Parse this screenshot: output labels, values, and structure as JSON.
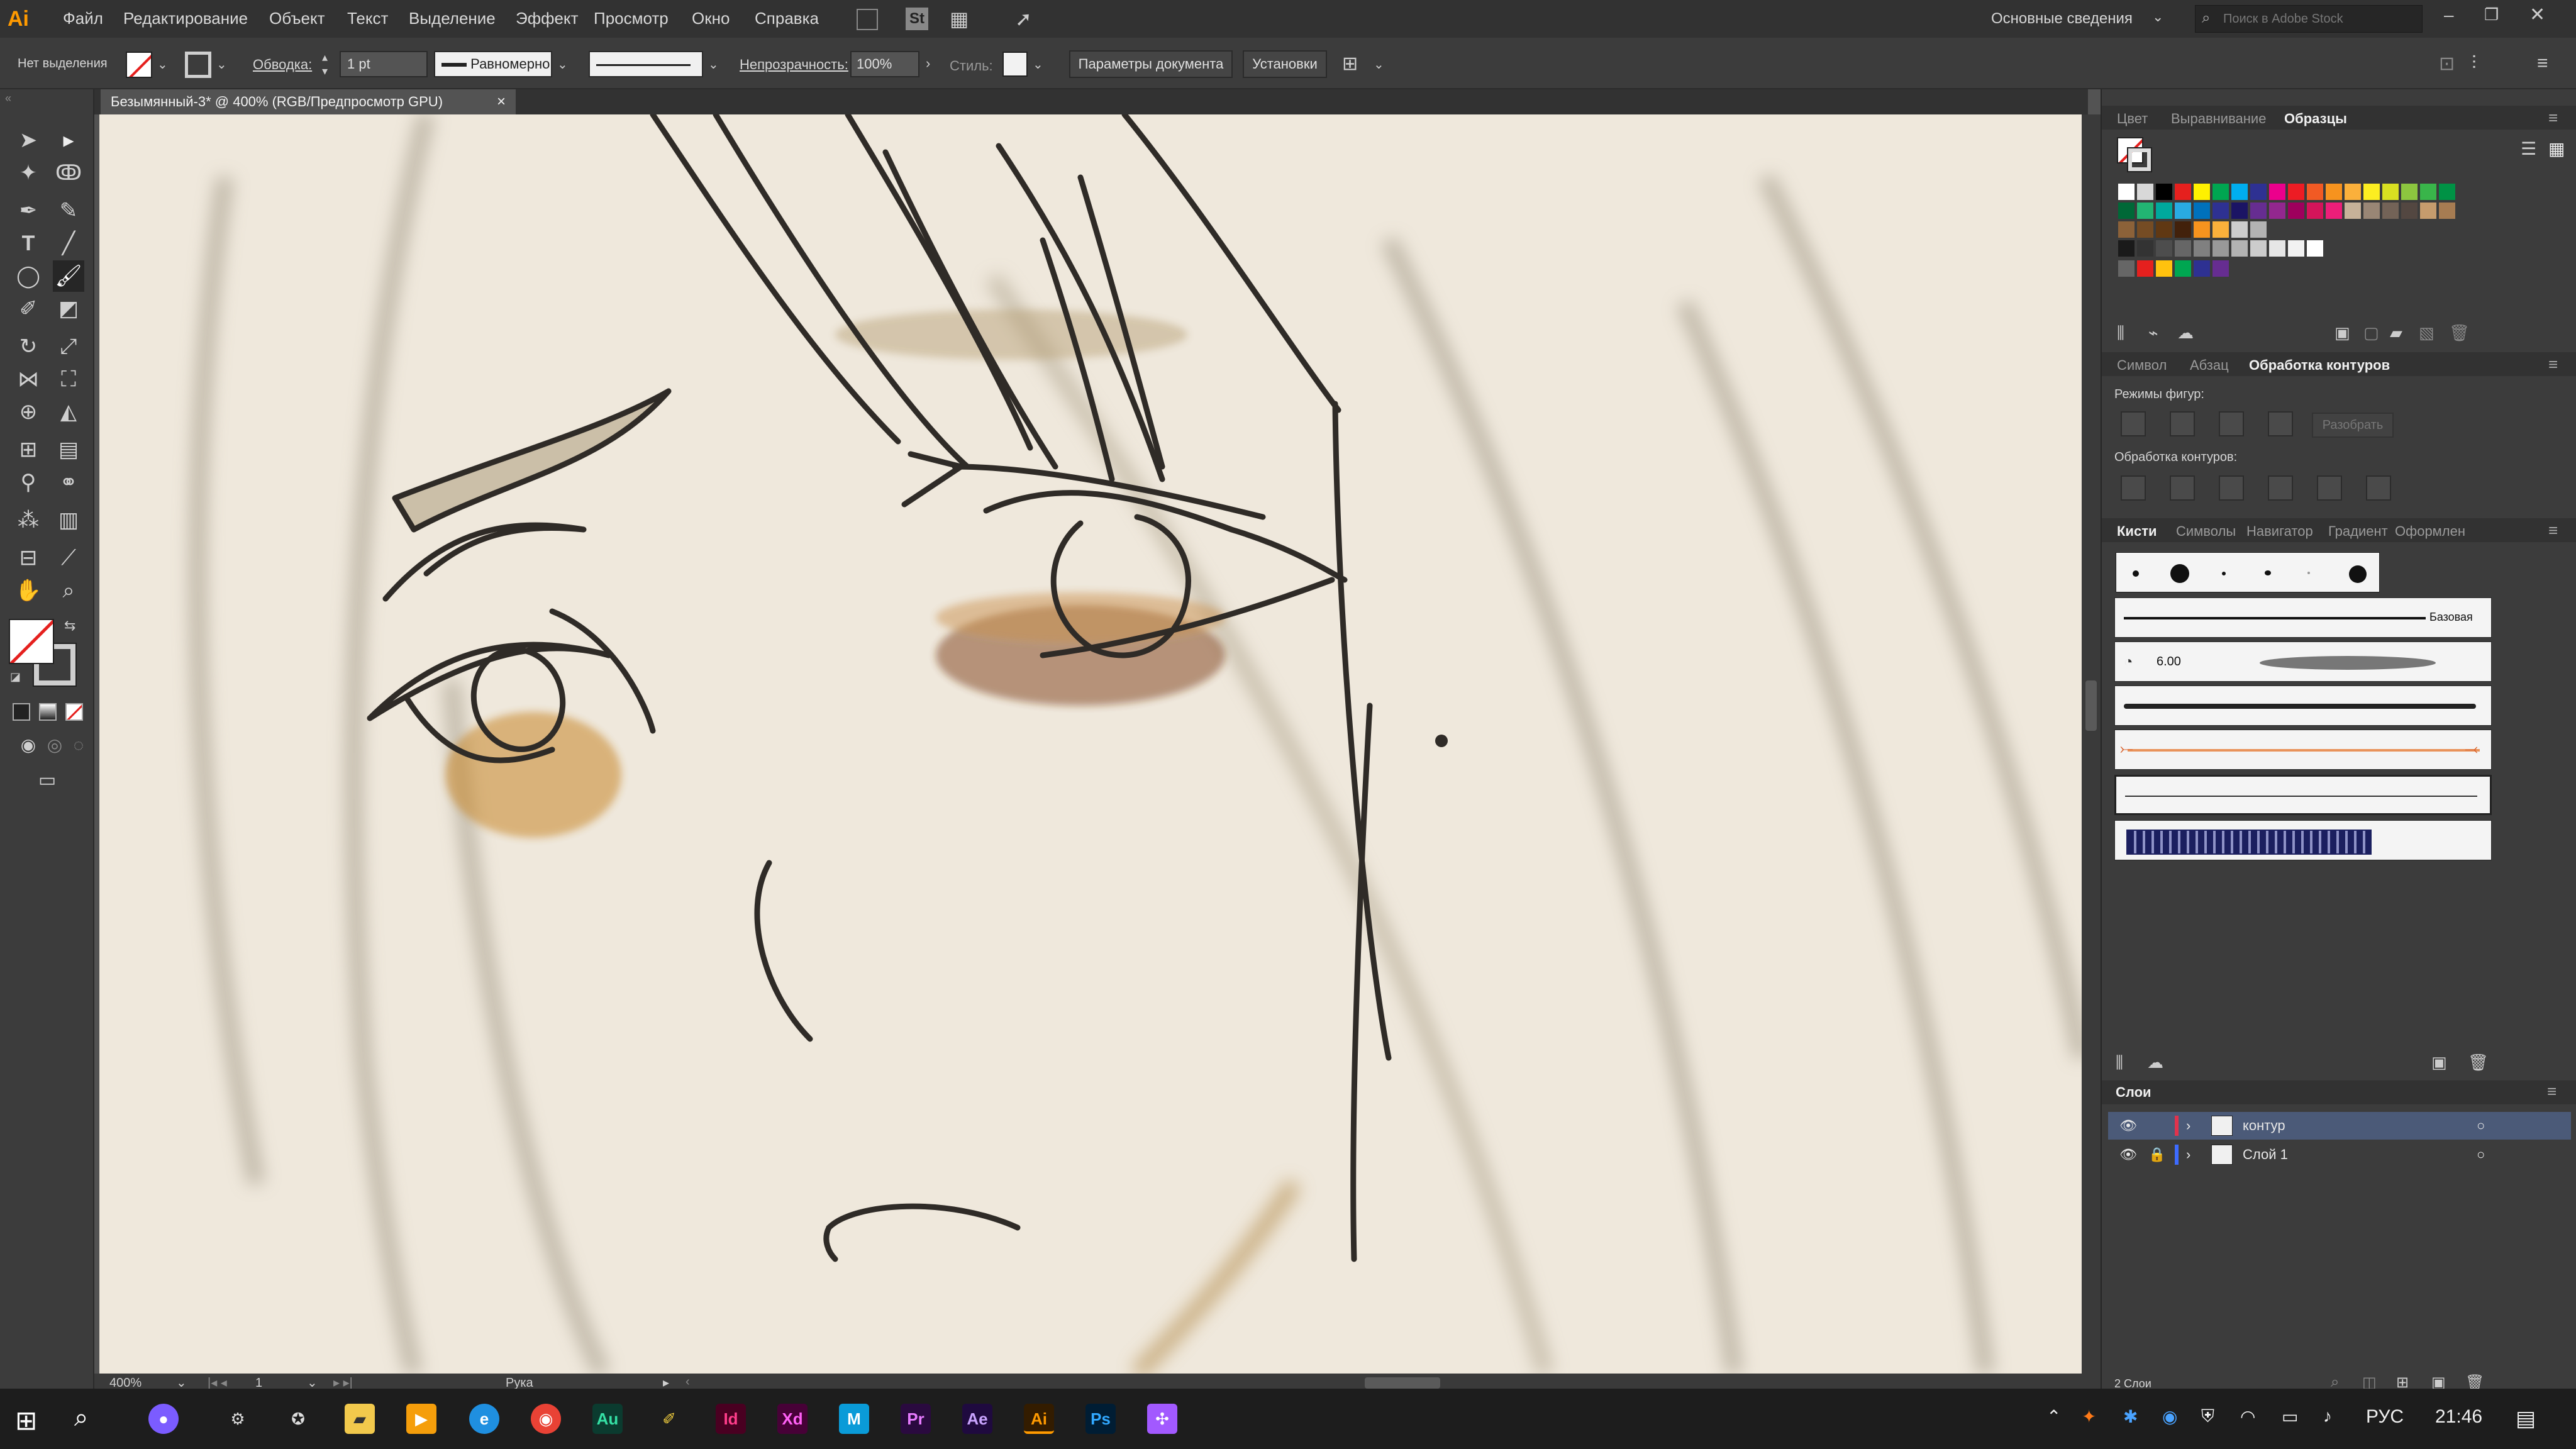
{
  "app": {
    "logo": "Ai",
    "menu": [
      "Файл",
      "Редактирование",
      "Объект",
      "Текст",
      "Выделение",
      "Эффект",
      "Просмотр",
      "Окно",
      "Справка"
    ],
    "workspace": "Основные сведения",
    "search_placeholder": "Поиск в Adobe Stock"
  },
  "control": {
    "selection": "Нет выделения",
    "stroke_label": "Обводка:",
    "stroke_value": "1 pt",
    "profile": "Равномерно",
    "opacity_label": "Непрозрачность:",
    "opacity_value": "100%",
    "style_label": "Стиль:",
    "doc_params": "Параметры документа",
    "prefs": "Установки"
  },
  "document": {
    "tab_title": "Безымянный-3* @ 400% (RGB/Предпросмотр GPU)",
    "zoom": "400%",
    "artboard": "1",
    "tool_status": "Рука"
  },
  "panels": {
    "top_tabs": [
      "Цвет",
      "Выравнивание",
      "Образцы"
    ],
    "top_active": "Образцы",
    "mid_tabs": [
      "Символ",
      "Абзац",
      "Обработка контуров"
    ],
    "mid_active": "Обработка контуров",
    "shape_modes": "Режимы фигур:",
    "expand": "Разобрать",
    "pathfinders": "Обработка контуров:",
    "brush_tabs": [
      "Кисти",
      "Символы",
      "Навигатор",
      "Градиент",
      "Оформлен"
    ],
    "brush_active": "Кисти",
    "brush_basic": "Базовая",
    "brush_size": "6.00",
    "layers_tab": "Слои",
    "layers": [
      {
        "name": "контур",
        "color": "#e0334d",
        "selected": true
      },
      {
        "name": "Слой 1",
        "color": "#3d6bff",
        "selected": false
      }
    ],
    "layers_count": "2 Слои"
  },
  "swatches": {
    "row1": [
      "#ffffff",
      "#d8d8d8",
      "#000000",
      "#e5201e",
      "#fff100",
      "#00a651",
      "#00aeef",
      "#2e3192",
      "#ec008c",
      "#ed1c24",
      "#f15a24",
      "#f7931e",
      "#fbb03b",
      "#fcee21",
      "#d9e021",
      "#8cc63f",
      "#39b54a",
      "#009245"
    ],
    "row2": [
      "#006837",
      "#22b573",
      "#00a99d",
      "#29abe2",
      "#0071bc",
      "#2e3192",
      "#1b1464",
      "#662d91",
      "#93278f",
      "#9e005d",
      "#d4145a",
      "#ed1e79",
      "#c7b299",
      "#998675",
      "#736357",
      "#534741",
      "#c69c6d",
      "#a67c52"
    ],
    "row3": [
      "#8c6239",
      "#754c24",
      "#603813",
      "#42210b",
      "#f7931e",
      "#fbb03b",
      "#cccccc",
      "#b3b3b3"
    ],
    "row4": [
      "#1a1a1a",
      "#333333",
      "#4d4d4d",
      "#666666",
      "#808080",
      "#999999",
      "#b3b3b3",
      "#cccccc",
      "#e6e6e6",
      "#f2f2f2",
      "#ffffff"
    ],
    "row5": [
      "#666666",
      "#e5201e",
      "#ffc20e",
      "#00a651",
      "#2e3192",
      "#662d91"
    ]
  },
  "taskbar": {
    "apps": [
      "Au",
      "Id",
      "Xd",
      "M",
      "Pr",
      "Ae",
      "Ai",
      "Ps"
    ],
    "lang": "РУС",
    "time": "21:46"
  }
}
